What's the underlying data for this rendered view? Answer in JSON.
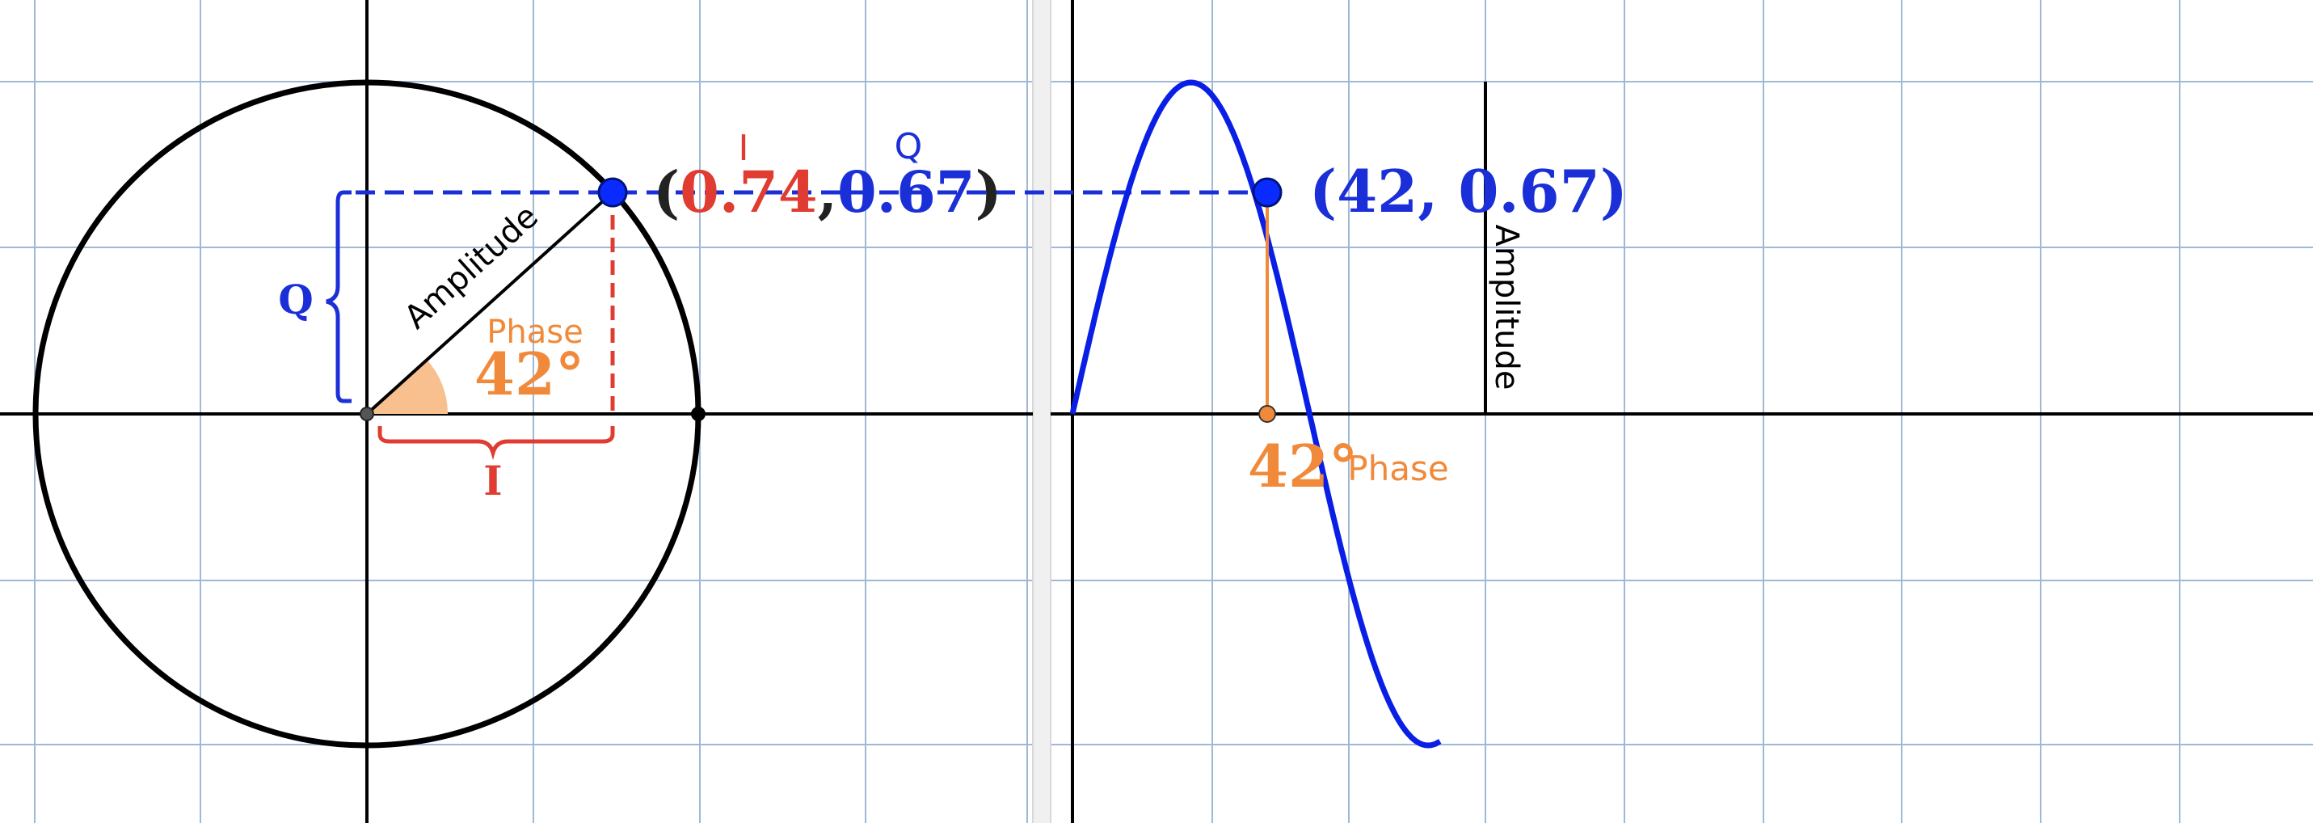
{
  "left_panel": {
    "point_label": {
      "open": "(",
      "i_value": "0.74",
      "comma": ",",
      "q_value": "0.67",
      "close": ")"
    },
    "i_header": "I",
    "q_header": "Q",
    "amplitude_label": "Amplitude",
    "phase_label": "Phase",
    "angle_label": "42°",
    "q_brace_label": "Q",
    "i_brace_label": "I"
  },
  "right_panel": {
    "point_label": "(42, 0.67)",
    "amplitude_label": "Amplitude",
    "angle_label": "42°",
    "phase_label": "Phase"
  },
  "colors": {
    "grid": "#9fb8d6",
    "axis": "#000000",
    "circle": "#000000",
    "sine": "#0a1fe6",
    "i_color": "#e03c31",
    "q_color": "#1a2fd8",
    "phase": "#f08a3a",
    "phase_fill": "#f9c08f"
  },
  "diagram": {
    "phase_deg": 42,
    "i": 0.74,
    "q": 0.67
  }
}
